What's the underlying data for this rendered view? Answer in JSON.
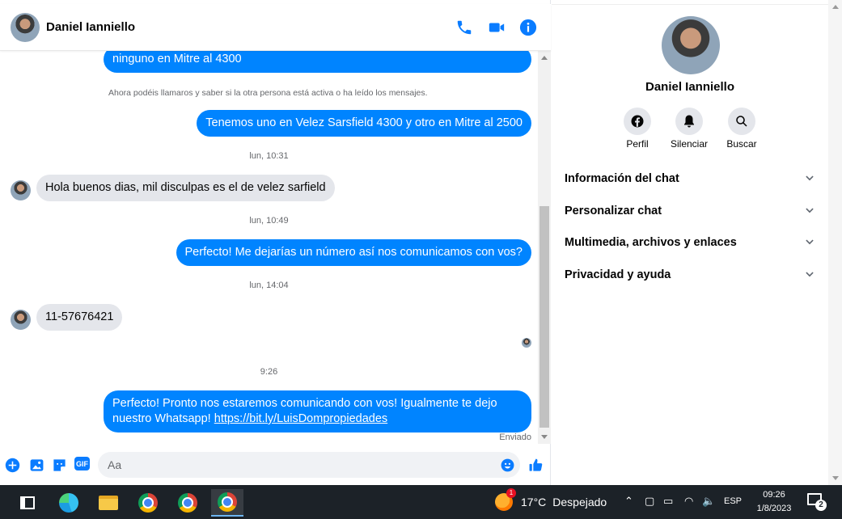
{
  "contact": {
    "name": "Daniel Ianniello"
  },
  "header": {
    "icons": [
      "phone-icon",
      "video-camera-icon",
      "info-icon"
    ]
  },
  "messages": [
    {
      "type": "outgoing",
      "text": "ninguno en Mitre al 4300"
    },
    {
      "type": "system",
      "text": "Ahora podéis llamaros y saber si la otra persona está activa o ha leído los mensajes."
    },
    {
      "type": "outgoing",
      "text": "Tenemos uno en Velez Sarsfield 4300 y otro en Mitre al 2500"
    },
    {
      "type": "timestamp",
      "text": "lun, 10:31"
    },
    {
      "type": "incoming",
      "text": "Hola buenos dias, mil disculpas es el de velez sarfield"
    },
    {
      "type": "timestamp",
      "text": "lun, 10:49"
    },
    {
      "type": "outgoing",
      "text": "Perfecto! Me dejarías un número así nos comunicamos con vos?"
    },
    {
      "type": "timestamp",
      "text": "lun, 14:04"
    },
    {
      "type": "incoming",
      "text": "11-57676421"
    },
    {
      "type": "timestamp",
      "text": "9:26"
    },
    {
      "type": "outgoing",
      "text": "Perfecto! Pronto nos estaremos comunicando con vos! Igualmente te dejo nuestro Whatsapp! ",
      "link": "https://bit.ly/LuisDompropiedades"
    }
  ],
  "sent_status": "Enviado",
  "composer": {
    "placeholder": "Aa",
    "gif_label": "GIF"
  },
  "info_panel": {
    "actions": [
      {
        "label": "Perfil",
        "icon": "facebook-icon"
      },
      {
        "label": "Silenciar",
        "icon": "bell-icon"
      },
      {
        "label": "Buscar",
        "icon": "search-icon"
      }
    ],
    "sections": [
      "Información del chat",
      "Personalizar chat",
      "Multimedia, archivos y enlaces",
      "Privacidad y ayuda"
    ]
  },
  "taskbar": {
    "weather": {
      "temp": "17°C",
      "condition": "Despejado",
      "badge": "1"
    },
    "language": "ESP",
    "time": "09:26",
    "date": "1/8/2023",
    "notifications": "2"
  },
  "colors": {
    "accent": "#0084ff",
    "incoming_bubble": "#e4e6eb",
    "taskbar": "#1c2228"
  }
}
